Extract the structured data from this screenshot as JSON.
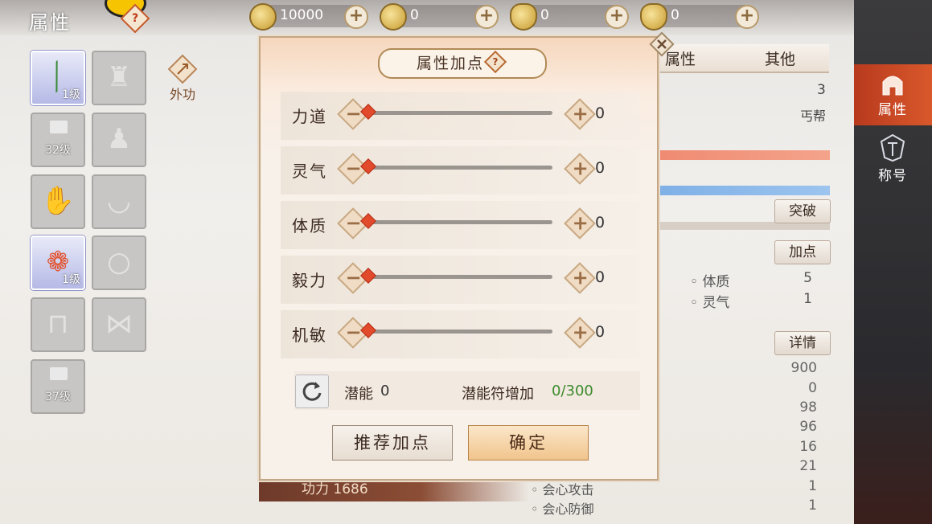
{
  "header": {
    "title": "属性",
    "help_symbol": "?",
    "resources": [
      {
        "icon": "copper-coin-icon",
        "value": "10000"
      },
      {
        "icon": "gold-coin-icon",
        "value": "0"
      },
      {
        "icon": "bound-ingot-icon",
        "value": "0"
      },
      {
        "icon": "gold-ingot-icon",
        "value": "0"
      }
    ],
    "plus_symbol": "+"
  },
  "equipment": {
    "slots": [
      {
        "icon": "weapon-icon",
        "level": "1级",
        "state": "equipped"
      },
      {
        "icon": "helmet-icon",
        "level": "",
        "state": "empty"
      },
      {
        "icon": "locked-chest-icon",
        "level": "32级",
        "state": "locked"
      },
      {
        "icon": "armor-icon",
        "level": "",
        "state": "empty"
      },
      {
        "icon": "gloves-icon",
        "level": "",
        "state": "empty"
      },
      {
        "icon": "necklace-icon",
        "level": "",
        "state": "empty"
      },
      {
        "icon": "ring-gem-icon",
        "level": "1级",
        "state": "equipped"
      },
      {
        "icon": "ring-icon",
        "level": "",
        "state": "empty"
      },
      {
        "icon": "boots-icon",
        "level": "",
        "state": "empty"
      },
      {
        "icon": "belt-icon",
        "level": "",
        "state": "empty"
      },
      {
        "icon": "locked-chest-icon",
        "level": "37级",
        "state": "locked"
      }
    ],
    "skill_label": "外功"
  },
  "right_panel": {
    "tabs": [
      "属性",
      "其他"
    ],
    "level": "3",
    "sect": "丐帮",
    "buttons": {
      "breakthrough": "突破",
      "add_points": "加点",
      "details": "详情"
    },
    "stats": [
      {
        "name": "体质",
        "value": "5"
      },
      {
        "name": "灵气",
        "value": "1"
      }
    ],
    "numbers": [
      "900",
      "0",
      "98",
      "96",
      "16",
      "21",
      "1",
      "1"
    ],
    "bottom_stats": [
      "会心攻击",
      "会心防御"
    ],
    "power_label": "功力 1686"
  },
  "side_nav": {
    "items": [
      {
        "label": "属性",
        "icon": "helmet-icon",
        "active": true
      },
      {
        "label": "称号",
        "icon": "emblem-icon",
        "active": false
      }
    ]
  },
  "modal": {
    "title": "属性加点",
    "help_symbol": "?",
    "attributes": [
      {
        "label": "力道",
        "value": "0"
      },
      {
        "label": "灵气",
        "value": "0"
      },
      {
        "label": "体质",
        "value": "0"
      },
      {
        "label": "毅力",
        "value": "0"
      },
      {
        "label": "机敏",
        "value": "0"
      }
    ],
    "minus_symbol": "−",
    "plus_symbol": "+",
    "potential_label": "潜能",
    "potential_value": "0",
    "rune_label": "潜能符增加",
    "rune_value": "0/300",
    "recommend_button": "推荐加点",
    "confirm_button": "确定"
  }
}
